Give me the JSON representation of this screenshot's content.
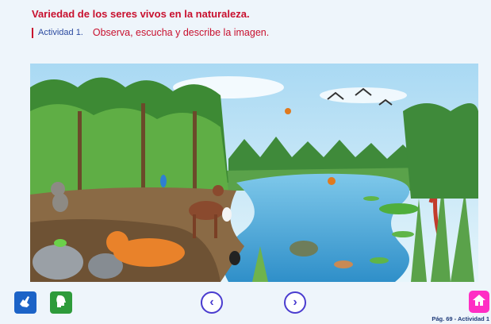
{
  "header": {
    "title": "Variedad de los seres vivos en la naturaleza.",
    "activity_label": "Actividad 1.",
    "activity_text": "Observa, escucha y describe la imagen."
  },
  "toolbar": {
    "sign_icon": "sign-language-icon",
    "audio_icon": "speaking-head-icon",
    "prev_icon": "chevron-left-icon",
    "next_icon": "chevron-right-icon",
    "home_icon": "home-icon"
  },
  "footer": {
    "page_ref": "Pág. 69 - Actividad 1"
  },
  "colors": {
    "title_red": "#c8102e",
    "activity_blue": "#2b4aa0",
    "nav_purple": "#4a3ccf",
    "home_pink": "#ff2ec4",
    "sign_blue": "#1c63c7",
    "audio_green": "#2e9b3a"
  }
}
